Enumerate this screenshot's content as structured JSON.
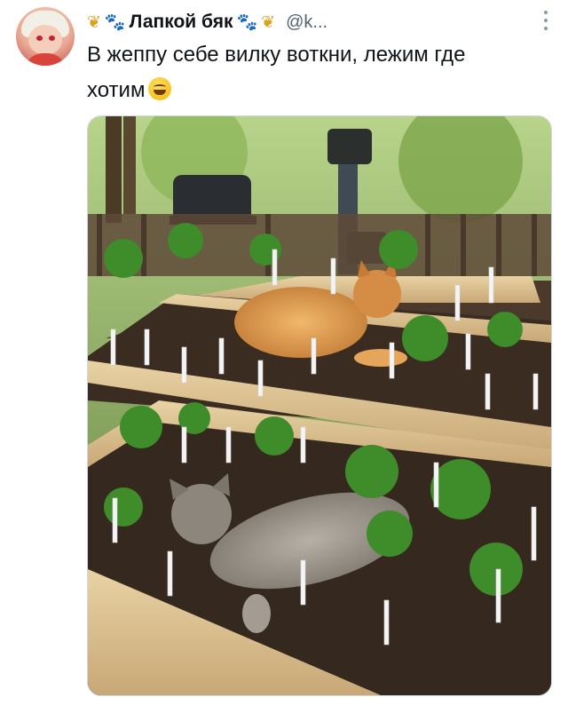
{
  "tweet": {
    "display_name": "Лапкой бяк",
    "handle": "@k...",
    "text_line1": "В жеппу себе вилку воткни, лежим где",
    "text_line2": "хотим"
  },
  "icons": {
    "decor_leaf": "leaf-icon",
    "decor_paw": "paw-icon",
    "emoji": "grinning-face-emoji",
    "more": "more-vertical-icon"
  },
  "colors": {
    "text": "#0f1419",
    "secondary": "#536471",
    "leaf": "#d9a520",
    "paw": "#3d8fd6"
  }
}
